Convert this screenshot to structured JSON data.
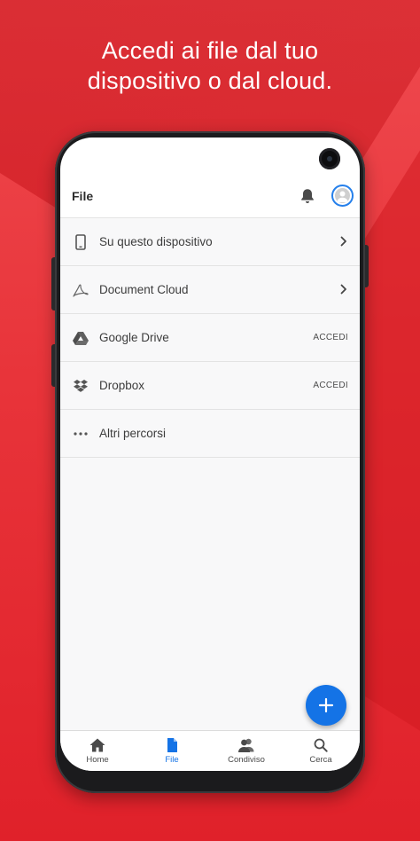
{
  "promo": {
    "line1": "Accedi ai file dal tuo",
    "line2": "dispositivo o dal cloud."
  },
  "appbar": {
    "title": "File",
    "icons": [
      "bell-icon",
      "avatar-icon"
    ]
  },
  "locations": [
    {
      "icon": "phone-icon",
      "label": "Su questo dispositivo",
      "trailing": "chevron"
    },
    {
      "icon": "acrobat-icon",
      "label": "Document Cloud",
      "trailing": "chevron"
    },
    {
      "icon": "google-drive-icon",
      "label": "Google Drive",
      "action": "ACCEDI"
    },
    {
      "icon": "dropbox-icon",
      "label": "Dropbox",
      "action": "ACCEDI"
    },
    {
      "icon": "more-icon",
      "label": "Altri percorsi"
    }
  ],
  "fab": {
    "icon": "plus-icon"
  },
  "tabs": [
    {
      "icon": "home-icon",
      "label": "Home",
      "active": false
    },
    {
      "icon": "file-icon",
      "label": "File",
      "active": true
    },
    {
      "icon": "people-icon",
      "label": "Condiviso",
      "active": false
    },
    {
      "icon": "search-icon",
      "label": "Cerca",
      "active": false
    }
  ],
  "colors": {
    "brand_red": "#e3262f",
    "accent_blue": "#1473e6",
    "text": "#3c3c3c"
  }
}
